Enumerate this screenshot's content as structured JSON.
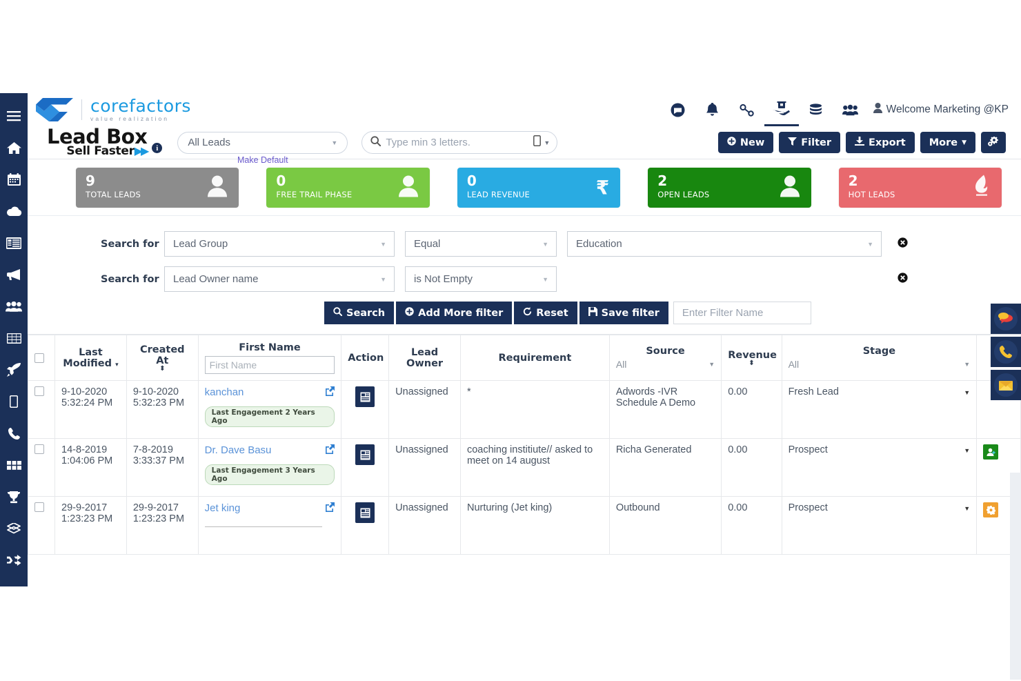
{
  "brand": {
    "logo_name": "corefactors",
    "logo_tagline": "value realization",
    "module_title": "Lead Box",
    "module_subtitle": "Sell Faster",
    "module_subtitle_arrows": "▶▶",
    "info_icon": "info-icon"
  },
  "header": {
    "icons": [
      {
        "name": "message-icon",
        "glyph": ""
      },
      {
        "name": "bell-icon",
        "glyph": ""
      },
      {
        "name": "link-icon",
        "glyph": ""
      },
      {
        "name": "handshake-support-icon",
        "glyph": ""
      },
      {
        "name": "money-stack-icon",
        "glyph": ""
      },
      {
        "name": "users-icon",
        "glyph": ""
      }
    ],
    "user_label": "Welcome Marketing @KP"
  },
  "toolbar": {
    "lead_select_value": "All Leads",
    "make_default_label": "Make Default",
    "search_placeholder": "Type min 3 letters.",
    "buttons": [
      {
        "name": "new-button",
        "label": "New",
        "icon": "plus-circle-icon"
      },
      {
        "name": "filter-button",
        "label": "Filter",
        "icon": "funnel-icon"
      },
      {
        "name": "export-button",
        "label": "Export",
        "icon": "download-icon"
      },
      {
        "name": "more-button",
        "label": "More",
        "icon": "chevron-down-icon"
      },
      {
        "name": "settings-button",
        "label": "",
        "icon": "gears-icon"
      }
    ]
  },
  "kpis": [
    {
      "value": "9",
      "label": "TOTAL LEADS",
      "color": "#8c8c8c",
      "icon": "person-icon"
    },
    {
      "value": "0",
      "label": "FREE TRAIL PHASE",
      "color": "#7ac943",
      "icon": "person-icon"
    },
    {
      "value": "0",
      "label": "LEAD REVENUE",
      "color": "#29abe2",
      "icon": "rupee-icon"
    },
    {
      "value": "2",
      "label": "OPEN LEADS",
      "color": "#18870f",
      "icon": "person-icon"
    },
    {
      "value": "2",
      "label": "HOT LEADS",
      "color": "#e8696e",
      "icon": "flame-icon"
    }
  ],
  "filters": {
    "label": "Search for",
    "rows": [
      {
        "field": "Lead Group",
        "operator": "Equal",
        "value": "Education",
        "has_value": true
      },
      {
        "field": "Lead Owner name",
        "operator": "is Not Empty",
        "value": "",
        "has_value": false
      }
    ],
    "buttons": [
      {
        "name": "search-button",
        "label": "Search",
        "icon": "magnifier-icon"
      },
      {
        "name": "add-more-filter-button",
        "label": "Add More filter",
        "icon": "plus-circle-icon"
      },
      {
        "name": "reset-button",
        "label": "Reset",
        "icon": "refresh-icon"
      },
      {
        "name": "save-filter-button",
        "label": "Save filter",
        "icon": "floppy-disk-icon"
      }
    ],
    "filter_name_placeholder": "Enter Filter Name"
  },
  "table": {
    "columns": [
      {
        "name": "select-all",
        "label": "",
        "sub": "",
        "type": "checkbox"
      },
      {
        "name": "last-modified",
        "label": "Last Modified",
        "sub": "",
        "type": "sort-desc"
      },
      {
        "name": "created-at",
        "label": "Created At",
        "sub": "",
        "type": "sort"
      },
      {
        "name": "first-name",
        "label": "First Name",
        "sub": "First Name",
        "type": "input"
      },
      {
        "name": "action",
        "label": "Action",
        "sub": "",
        "type": "plain"
      },
      {
        "name": "lead-owner",
        "label": "Lead Owner",
        "sub": "",
        "type": "plain"
      },
      {
        "name": "requirement",
        "label": "Requirement",
        "sub": "",
        "type": "plain"
      },
      {
        "name": "source",
        "label": "Source",
        "sub": "All",
        "type": "select"
      },
      {
        "name": "revenue",
        "label": "Revenue",
        "sub": "",
        "type": "sort"
      },
      {
        "name": "stage",
        "label": "Stage",
        "sub": "All",
        "type": "select"
      },
      {
        "name": "status",
        "label": "",
        "sub": "",
        "type": "plain"
      }
    ],
    "rows": [
      {
        "last_modified_date": "9-10-2020",
        "last_modified_time": "5:32:24 PM",
        "created_date": "9-10-2020",
        "created_time": "5:32:23 PM",
        "first_name": "kanchan",
        "engagement": "Last Engagement 2 Years Ago",
        "lead_owner": "Unassigned",
        "requirement": "*",
        "source": "Adwords -IVR Schedule A Demo",
        "revenue": "0.00",
        "stage": "Fresh Lead",
        "badge_color": "none",
        "badge_icon": ""
      },
      {
        "last_modified_date": "14-8-2019",
        "last_modified_time": "1:04:06 PM",
        "created_date": "7-8-2019",
        "created_time": "3:33:37 PM",
        "first_name": "Dr. Dave Basu",
        "engagement": "Last Engagement 3 Years Ago",
        "lead_owner": "Unassigned",
        "requirement": "coaching institiute// asked to meet on 14 august",
        "source": "Richa Generated",
        "revenue": "0.00",
        "stage": "Prospect",
        "badge_color": "#1a8a1a",
        "badge_icon": "person-add-icon"
      },
      {
        "last_modified_date": "29-9-2017",
        "last_modified_time": "1:23:23 PM",
        "created_date": "29-9-2017",
        "created_time": "1:23:23 PM",
        "first_name": "Jet king",
        "engagement": "",
        "lead_owner": "Unassigned",
        "requirement": "Nurturing (Jet king)",
        "source": "Outbound",
        "revenue": "0.00",
        "stage": "Prospect",
        "badge_color": "#f0a030",
        "badge_icon": "gear-icon"
      }
    ]
  },
  "sidebar": {
    "items": [
      {
        "name": "menu-toggle-icon",
        "label": "menu"
      },
      {
        "name": "home-icon",
        "label": "home"
      },
      {
        "name": "calendar-icon",
        "label": "calendar"
      },
      {
        "name": "cloud-icon",
        "label": "cloud"
      },
      {
        "name": "list-box-icon",
        "label": "lead box"
      },
      {
        "name": "megaphone-icon",
        "label": "campaigns"
      },
      {
        "name": "users-group-icon",
        "label": "teams"
      },
      {
        "name": "table-grid-icon",
        "label": "grid"
      },
      {
        "name": "rocket-icon",
        "label": "launch"
      },
      {
        "name": "mobile-icon",
        "label": "mobile"
      },
      {
        "name": "phone-icon",
        "label": "calls"
      },
      {
        "name": "apps-icon",
        "label": "apps"
      },
      {
        "name": "trophy-icon",
        "label": "rewards"
      },
      {
        "name": "ticket-icon",
        "label": "tickets"
      },
      {
        "name": "shuffle-icon",
        "label": "shuffle"
      }
    ]
  },
  "floating": [
    {
      "name": "chat-float-button",
      "icon": "speech-bubbles-icon"
    },
    {
      "name": "call-float-button",
      "icon": "phone-handset-icon"
    },
    {
      "name": "email-float-button",
      "icon": "envelope-icon"
    }
  ]
}
